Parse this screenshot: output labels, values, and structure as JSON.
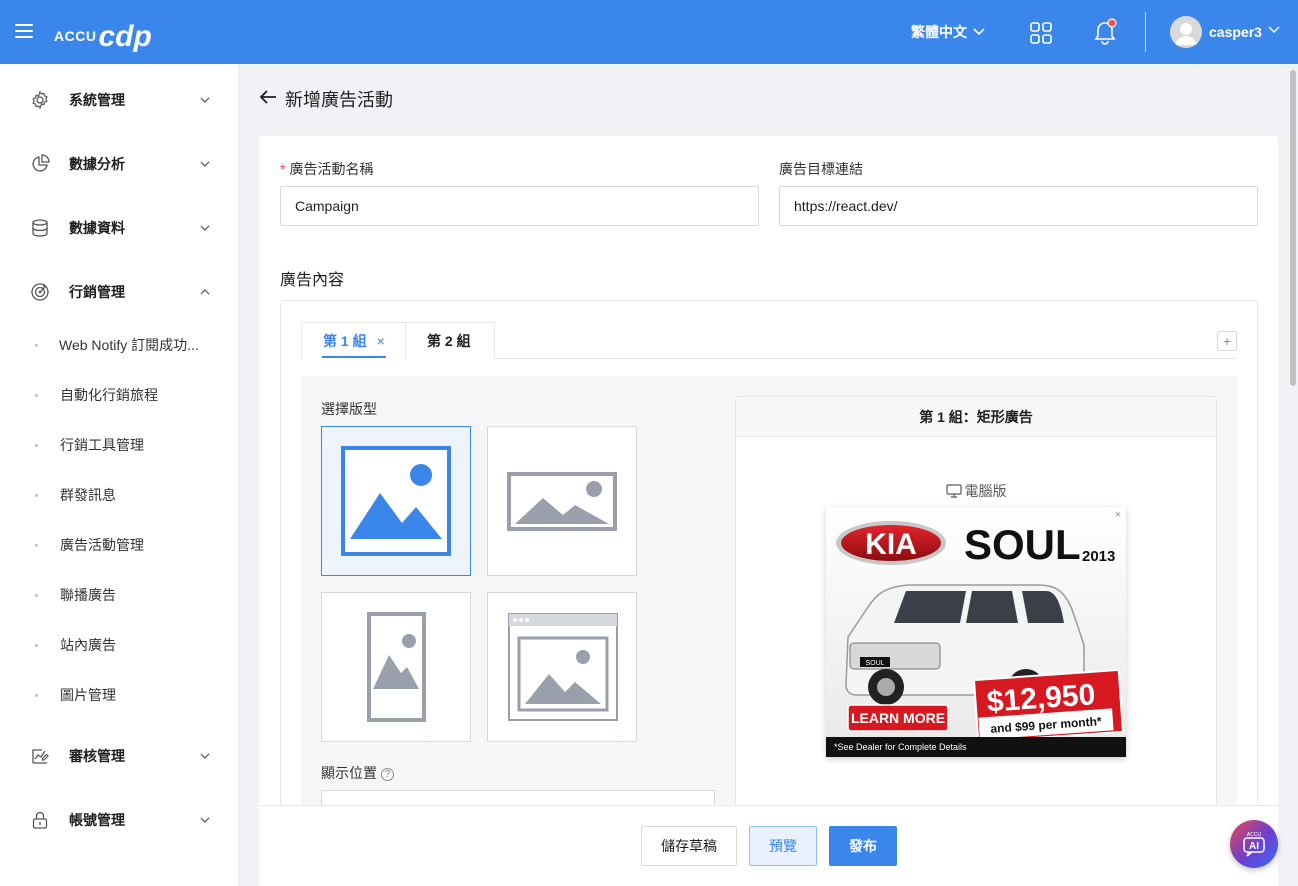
{
  "header": {
    "logo_small": "ACCU",
    "logo_big": "cdp",
    "language": "繁體中文",
    "username": "casper3",
    "colors": {
      "bar": "#3b86eb",
      "notification_dot": "#ff4d4f"
    }
  },
  "sidebar": {
    "items": [
      {
        "label": "系統管理",
        "icon": "gear-icon"
      },
      {
        "label": "數據分析",
        "icon": "pie-chart-icon"
      },
      {
        "label": "數據資料",
        "icon": "database-icon"
      },
      {
        "label": "行銷管理",
        "icon": "target-icon"
      },
      {
        "label": "審核管理",
        "icon": "audit-icon"
      },
      {
        "label": "帳號管理",
        "icon": "lock-icon"
      }
    ],
    "marketing_sub_items": [
      "Web Notify 訂閱成功...",
      "自動化行銷旅程",
      "行銷工具管理",
      "群發訊息",
      "廣告活動管理",
      "聯播廣告",
      "站內廣告",
      "圖片管理"
    ]
  },
  "page": {
    "title": "新增廣告活動",
    "campaign_name_label": "廣告活動名稱",
    "campaign_name_value": "Campaign",
    "target_url_label": "廣告目標連結",
    "target_url_value": "https://react.dev/",
    "content_title": "廣告內容",
    "tabs": [
      {
        "label": "第 1 組",
        "active": true,
        "closable": true
      },
      {
        "label": "第 2 組",
        "active": false,
        "closable": false
      }
    ],
    "add_tab_symbol": "+",
    "close_symbol": "×",
    "choose_layout_label": "選擇版型",
    "position_label": "顯示位置",
    "help_symbol": "?",
    "preview_title": "第 1 組：矩形廣告",
    "device_label": "電腦版"
  },
  "ad": {
    "brand": "KIA",
    "model": "SOUL",
    "year": "2013",
    "price": "$12,950",
    "monthly": "and $99 per month*",
    "cta": "LEARN MORE",
    "disclaimer": "*See Dealer for Complete Details",
    "close": "×"
  },
  "footer": {
    "draft": "儲存草稿",
    "preview": "預覽",
    "publish": "發布"
  },
  "ai_button": {
    "small": "ACCU",
    "big": "AI"
  }
}
